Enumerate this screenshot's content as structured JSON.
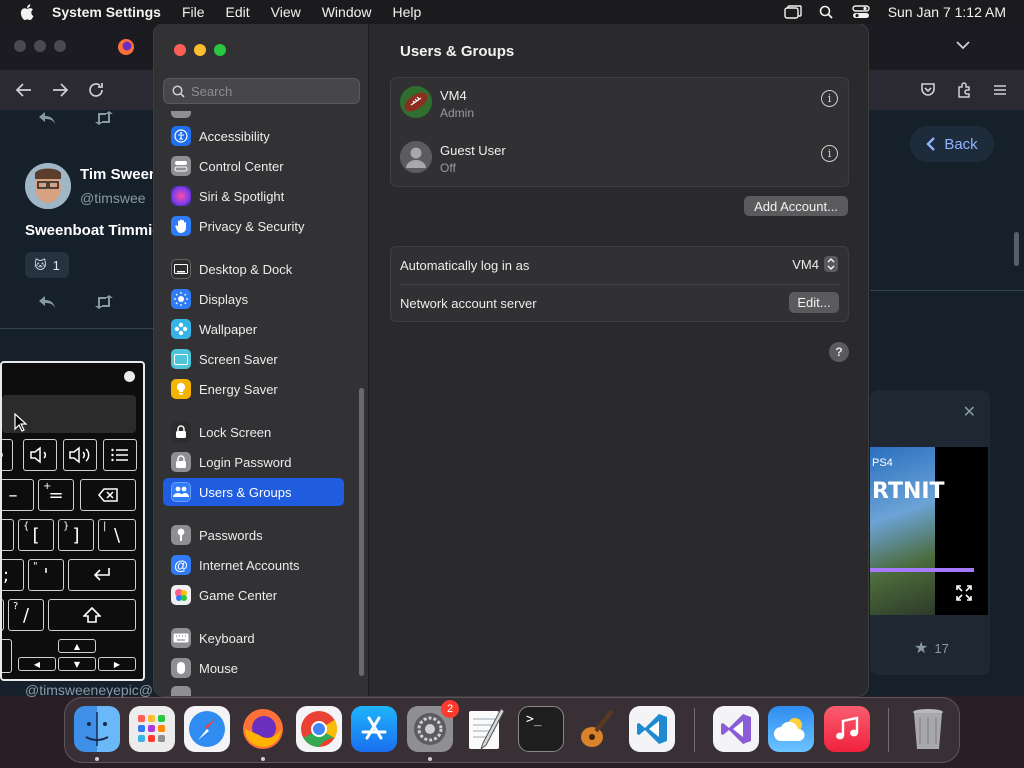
{
  "menubar": {
    "app_name": "System Settings",
    "menus": [
      "File",
      "Edit",
      "View",
      "Window",
      "Help"
    ],
    "clock": "Sun Jan 7  1:12 AM"
  },
  "browser": {
    "tweet": {
      "name": "Tim Sween",
      "handle": "@timswee",
      "text": "Sweenboat Timmie",
      "reaction_count": "1",
      "footer_handle": "@timsweeneyepic@"
    },
    "back_label": "Back",
    "card": {
      "platform": "PS4",
      "game": "RTNIT",
      "likes": "17"
    }
  },
  "settings": {
    "search_placeholder": "Search",
    "sidebar": [
      {
        "label": "Accessibility",
        "icon": "accessibility-icon",
        "color": "#1f6ff0"
      },
      {
        "label": "Control Center",
        "icon": "control-center-icon",
        "color": "#8e8e93"
      },
      {
        "label": "Siri & Spotlight",
        "icon": "siri-icon",
        "color": "#b03bd8"
      },
      {
        "label": "Privacy & Security",
        "icon": "hand-icon",
        "color": "#2f7cf6"
      },
      {
        "label": "Desktop & Dock",
        "icon": "desktop-icon",
        "color": "#2c2c2e"
      },
      {
        "label": "Displays",
        "icon": "displays-icon",
        "color": "#2f7cf6"
      },
      {
        "label": "Wallpaper",
        "icon": "wallpaper-icon",
        "color": "#36b4e8"
      },
      {
        "label": "Screen Saver",
        "icon": "screen-saver-icon",
        "color": "#4fc3d9"
      },
      {
        "label": "Energy Saver",
        "icon": "energy-saver-icon",
        "color": "#f5b400"
      },
      {
        "label": "Lock Screen",
        "icon": "lock-icon",
        "color": "#2c2c2e"
      },
      {
        "label": "Login Password",
        "icon": "login-password-icon",
        "color": "#8e8e93"
      },
      {
        "label": "Users & Groups",
        "icon": "users-icon",
        "color": "#2f7cf6"
      },
      {
        "label": "Passwords",
        "icon": "key-icon",
        "color": "#8e8e93"
      },
      {
        "label": "Internet Accounts",
        "icon": "at-icon",
        "color": "#2f7cf6"
      },
      {
        "label": "Game Center",
        "icon": "game-center-icon",
        "color": "#f0f0f0"
      },
      {
        "label": "Keyboard",
        "icon": "keyboard-icon",
        "color": "#8e8e93"
      },
      {
        "label": "Mouse",
        "icon": "mouse-icon",
        "color": "#8e8e93"
      }
    ],
    "selected": "Users & Groups",
    "page_title": "Users & Groups",
    "users": [
      {
        "name": "VM4",
        "role": "Admin"
      },
      {
        "name": "Guest User",
        "role": "Off"
      }
    ],
    "add_account_label": "Add Account...",
    "auto_login_label": "Automatically log in as",
    "auto_login_value": "VM4",
    "network_server_label": "Network account server",
    "edit_label": "Edit...",
    "help_label": "?"
  },
  "dock": {
    "system_settings_badge": "2",
    "apps": [
      "Finder",
      "Launchpad",
      "Safari",
      "Firefox",
      "Chrome",
      "App Store",
      "System Settings",
      "TextEdit",
      "Terminal",
      "GarageBand",
      "Visual Studio Code",
      "Visual Studio",
      "Weather",
      "Music",
      "Trash"
    ]
  }
}
